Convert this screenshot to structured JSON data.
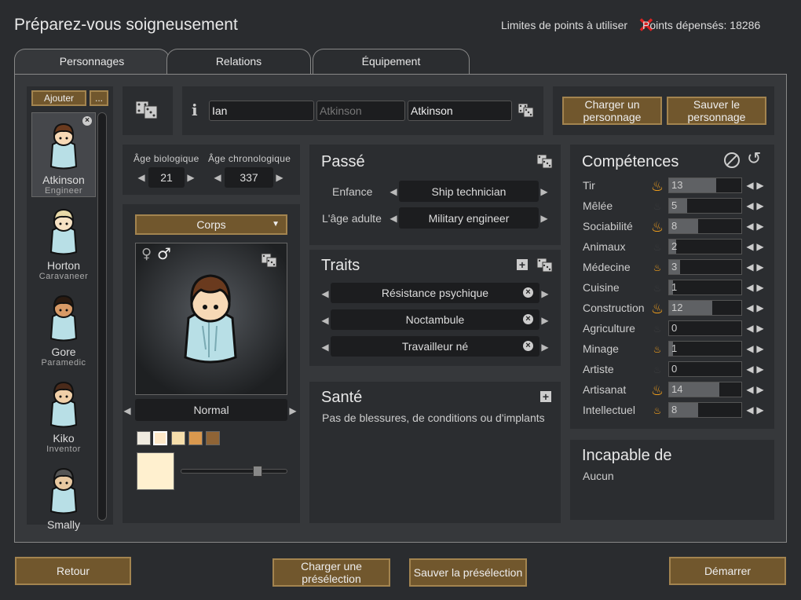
{
  "header": {
    "title": "Préparez-vous soigneusement",
    "limits": "Limites de points à utiliser",
    "spent": "Points dépensés: 18286"
  },
  "tabs": [
    {
      "label": "Personnages"
    },
    {
      "label": "Relations"
    },
    {
      "label": "Équipement"
    }
  ],
  "list": {
    "add": "Ajouter",
    "more": "...",
    "pawns": [
      {
        "name": "Atkinson",
        "job": "Engineer"
      },
      {
        "name": "Horton",
        "job": "Caravaneer"
      },
      {
        "name": "Gore",
        "job": "Paramedic"
      },
      {
        "name": "Kiko",
        "job": "Inventor"
      },
      {
        "name": "Smally",
        "job": ""
      }
    ]
  },
  "names": {
    "first": "Ian",
    "nick_placeholder": "Atkinson",
    "last": "Atkinson"
  },
  "char_buttons": {
    "load": "Charger un personnage",
    "save": "Sauver le personnage"
  },
  "ages": {
    "bio_label": "Âge biologique",
    "bio": "21",
    "chrono_label": "Âge chronologique",
    "chrono": "337"
  },
  "appearance": {
    "dropdown": "Corps",
    "body_type": "Normal",
    "female": "♀",
    "male": "♂",
    "colors": [
      "#f0ebe0",
      "#fde8c8",
      "#f6deab",
      "#d9984e",
      "#8f6436"
    ],
    "selected_color": "#fff0cf",
    "slider": 0.74
  },
  "background": {
    "title": "Passé",
    "childhood_label": "Enfance",
    "childhood": "Ship technician",
    "adult_label": "L'âge adulte",
    "adult": "Military engineer"
  },
  "traits": {
    "title": "Traits",
    "items": [
      "Résistance psychique",
      "Noctambule",
      "Travailleur né"
    ]
  },
  "health": {
    "title": "Santé",
    "text": "Pas de blessures, de conditions ou d'implants"
  },
  "skills": {
    "title": "Compétences",
    "max": 20,
    "items": [
      {
        "name": "Tir",
        "level": 13,
        "passion": "major"
      },
      {
        "name": "Mêlée",
        "level": 5,
        "passion": "none"
      },
      {
        "name": "Sociabilité",
        "level": 8,
        "passion": "major"
      },
      {
        "name": "Animaux",
        "level": 2,
        "passion": "none"
      },
      {
        "name": "Médecine",
        "level": 3,
        "passion": "minor"
      },
      {
        "name": "Cuisine",
        "level": 1,
        "passion": "none"
      },
      {
        "name": "Construction",
        "level": 12,
        "passion": "major"
      },
      {
        "name": "Agriculture",
        "level": 0,
        "passion": "none"
      },
      {
        "name": "Minage",
        "level": 1,
        "passion": "minor"
      },
      {
        "name": "Artiste",
        "level": 0,
        "passion": "none"
      },
      {
        "name": "Artisanat",
        "level": 14,
        "passion": "major"
      },
      {
        "name": "Intellectuel",
        "level": 8,
        "passion": "minor"
      }
    ]
  },
  "incapable": {
    "title": "Incapable de",
    "text": "Aucun"
  },
  "footer": {
    "back": "Retour",
    "load_preset": "Charger une présélection",
    "save_preset": "Sauver la présélection",
    "start": "Démarrer"
  }
}
